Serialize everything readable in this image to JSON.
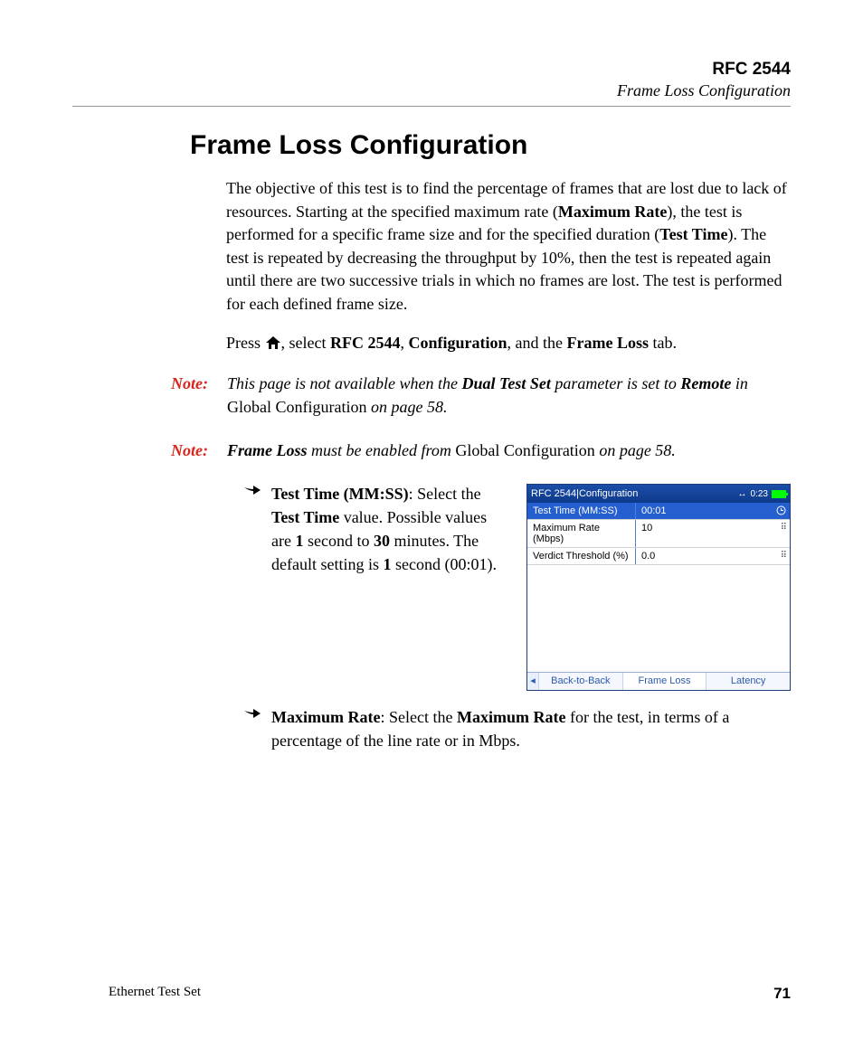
{
  "header": {
    "title": "RFC 2544",
    "subtitle": "Frame Loss Configuration"
  },
  "section": {
    "title": "Frame Loss Configuration"
  },
  "para1": {
    "a": "The objective of this test is to find the percentage of frames that are lost due to lack of resources. Starting at the specified maximum rate (",
    "maxrate": "Maximum Rate",
    "b": "), the test is performed for a specific frame size and for the specified duration (",
    "testtime": "Test Time",
    "c": "). The test is repeated by decreasing the throughput by 10%, then the test is repeated again until there are two successive trials in which no frames are lost. The test is performed for each defined frame size."
  },
  "para2": {
    "a": "Press ",
    "b": ", select ",
    "rfc": "RFC 2544",
    "c": ", ",
    "cfg": "Configuration",
    "d": ", and the ",
    "tab": "Frame Loss",
    "e": " tab."
  },
  "note_label": "Note:",
  "note1": {
    "a": "This page is not available when the ",
    "dual": "Dual Test Set",
    "b": " parameter is set to ",
    "remote": "Remote",
    "c": " in ",
    "gcfg": "Global Configuration",
    "d": " on page 58."
  },
  "note2": {
    "fl": "Frame Loss",
    "a": " must be enabled from ",
    "gcfg": "Global Configuration",
    "b": " on page 58."
  },
  "bullet1": {
    "tt_b": "Test Time (MM:SS)",
    "a": ": Select the ",
    "tt_b2": "Test Time",
    "b": " value. Possible values are ",
    "one": "1",
    "c": " second to ",
    "thirty": "30",
    "d": " minutes. The default setting is ",
    "one2": "1",
    "e": " second (00:01)."
  },
  "bullet2": {
    "mr_b": "Maximum Rate",
    "a": ": Select the ",
    "mr_b2": "Maximum Rate",
    "b": " for the test, in terms of a percentage of the line rate or in Mbps."
  },
  "device": {
    "title": "RFC 2544|Configuration",
    "clock": "0:23",
    "rows": [
      {
        "label": "Test Time (MM:SS)",
        "value": "00:01"
      },
      {
        "label": "Maximum Rate (Mbps)",
        "value": "10"
      },
      {
        "label": "Verdict Threshold (%)",
        "value": "0.0"
      }
    ],
    "tabs": {
      "nav_left": "◂",
      "back_to_back": "Back-to-Back",
      "frame_loss": "Frame Loss",
      "latency": "Latency"
    }
  },
  "footer": {
    "product": "Ethernet Test Set",
    "page": "71"
  }
}
